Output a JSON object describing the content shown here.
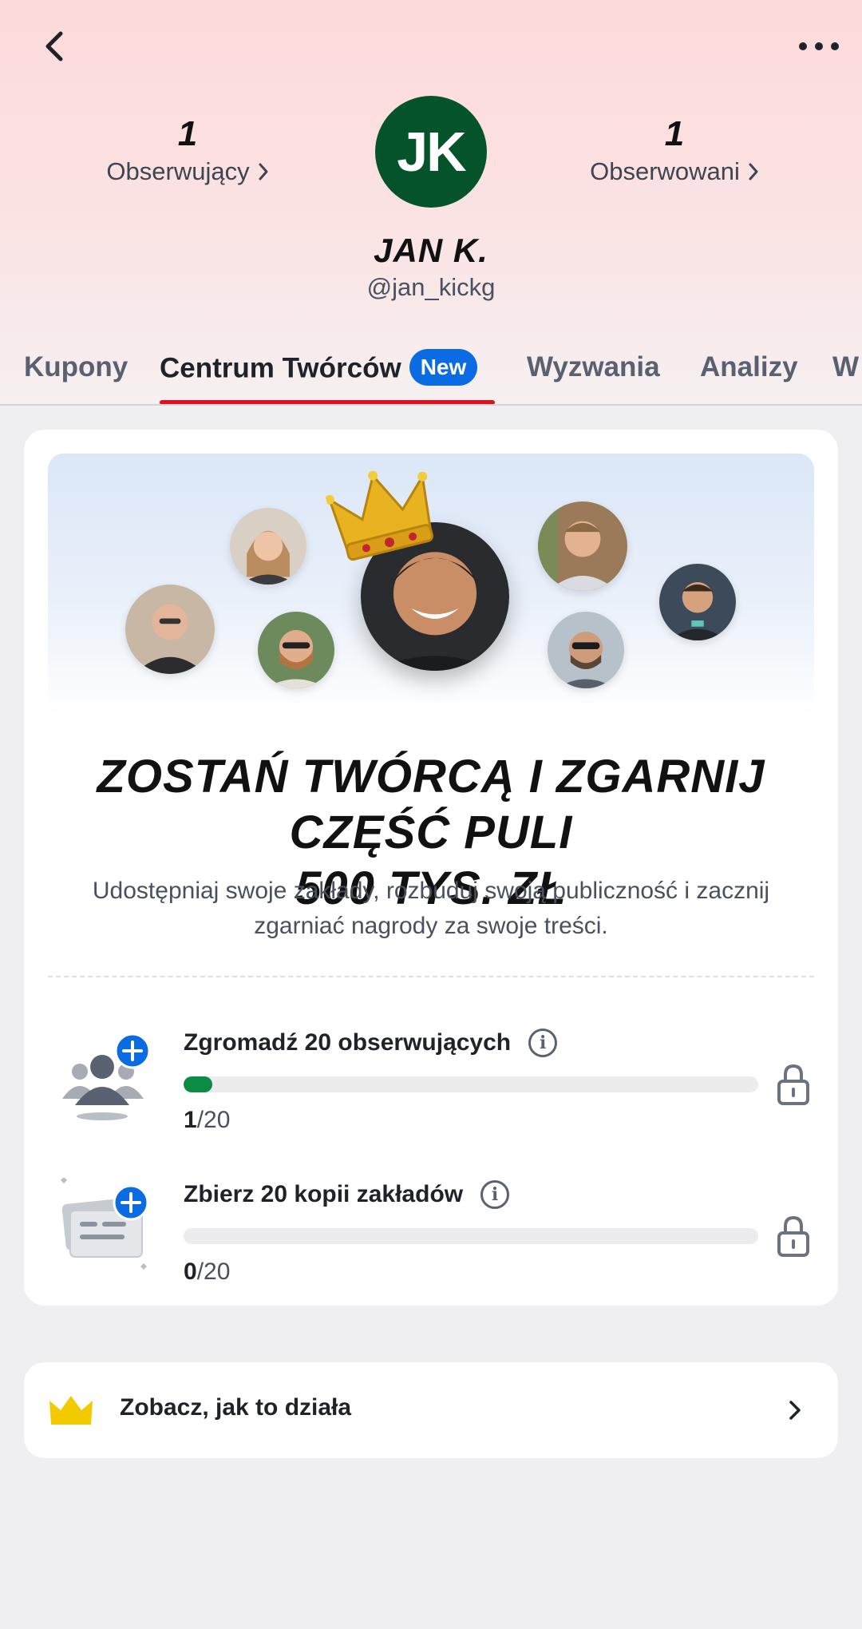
{
  "profile": {
    "initials": "JK",
    "name": "JAN K.",
    "handle": "@jan_kickg",
    "followers_count": "1",
    "followers_label": "Obserwujący",
    "following_count": "1",
    "following_label": "Obserwowani",
    "avatar_color": "#05532b"
  },
  "tabs": [
    {
      "label": "Kupony"
    },
    {
      "label": "Centrum Twórców",
      "badge": "New",
      "active": true
    },
    {
      "label": "Wyzwania"
    },
    {
      "label": "Analizy"
    },
    {
      "label": "W"
    }
  ],
  "creator_card": {
    "headline_line1": "ZOSTAŃ TWÓRCĄ I ZGARNIJ CZĘŚĆ PULI",
    "headline_line2": "500 TYS. ZŁ",
    "description_line1": "Udostępniaj swoje zakłady, rozbuduj swoją publiczność i zacznij",
    "description_line2": "zgarniać nagrody za swoje treści.",
    "tasks": [
      {
        "title": "Zgromadź 20 obserwujących",
        "current": "1",
        "total": "/20",
        "progress": 0.05,
        "icon": "followers-plus-icon"
      },
      {
        "title": "Zbierz 20 kopii zakładów",
        "current": "0",
        "total": "/20",
        "progress": 0.0,
        "icon": "bet-slip-copy-icon"
      }
    ]
  },
  "howto": {
    "label": "Zobacz, jak to działa",
    "icon": "crown-icon"
  },
  "colors": {
    "accent_red": "#e0101c",
    "badge_blue": "#0b6be2",
    "progress_green": "#0b8b43",
    "crown_yellow": "#f1cb00"
  }
}
